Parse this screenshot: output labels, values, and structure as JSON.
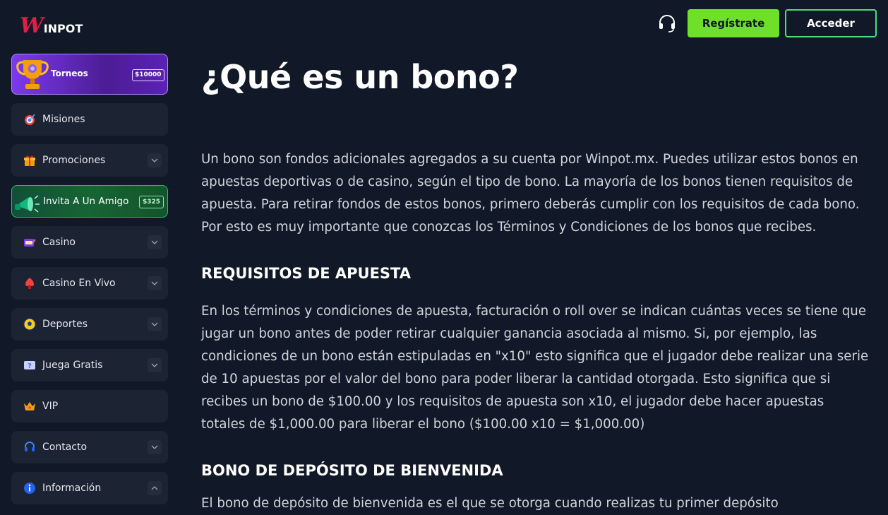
{
  "header": {
    "logo_w": "W",
    "logo_rest": "INPOT",
    "register_label": "Regístrate",
    "login_label": "Acceder"
  },
  "sidebar": {
    "torneos": {
      "label": "Torneos",
      "badge": "$10000"
    },
    "invita": {
      "label": "Invita A Un Amigo",
      "badge": "$325"
    },
    "items": [
      {
        "label": "Misiones",
        "icon": "target-icon"
      },
      {
        "label": "Promociones",
        "icon": "gift-icon"
      },
      {
        "label": "Casino",
        "icon": "slot-machine-icon"
      },
      {
        "label": "Casino En Vivo",
        "icon": "poker-chip-icon"
      },
      {
        "label": "Deportes",
        "icon": "soccer-ball-icon"
      },
      {
        "label": "Juega Gratis",
        "icon": "question-card-icon"
      },
      {
        "label": "VIP",
        "icon": "crown-icon"
      },
      {
        "label": "Contacto",
        "icon": "headset-icon"
      },
      {
        "label": "Información",
        "icon": "info-icon"
      }
    ]
  },
  "content": {
    "title": "¿Qué es un bono?",
    "intro": "Un bono son fondos adicionales agregados a su cuenta por Winpot.mx. Puedes utilizar estos bonos en apuestas deportivas o de casino, según el tipo de bono. La mayoría de los bonos tienen requisitos de apuesta. Para retirar fondos de estos bonos, primero deberás cumplir con los requisitos de cada bono. Por esto es muy importante que conozcas los Términos y Condiciones de los bonos que recibes.",
    "section1_title": "REQUISITOS DE APUESTA",
    "section1_text": "En los términos y condiciones de apuesta, facturación o roll over se indican cuántas veces se tiene que jugar un bono antes de poder retirar cualquier ganancia asociada al mismo. Si, por ejemplo, las condiciones de un bono están estipuladas en \"x10\" esto significa que el jugador debe realizar una serie de 10 apuestas por el valor del bono para poder liberar la cantidad otorgada. Esto significa que si recibes un bono de $100.00 y los requisitos de apuesta son x10, el jugador debe hacer apuestas totales de $1,000.00 para liberar el bono ($100.00 x10 = $1,000.00)",
    "section2_title": "BONO DE DEPÓSITO DE BIENVENIDA",
    "section2_text": "El bono de depósito de bienvenida es el que se otorga cuando realizas tu primer depósito"
  },
  "colors": {
    "background": "#111827",
    "accent_green": "#6ee02a",
    "sidebar_item": "#1c2333"
  }
}
